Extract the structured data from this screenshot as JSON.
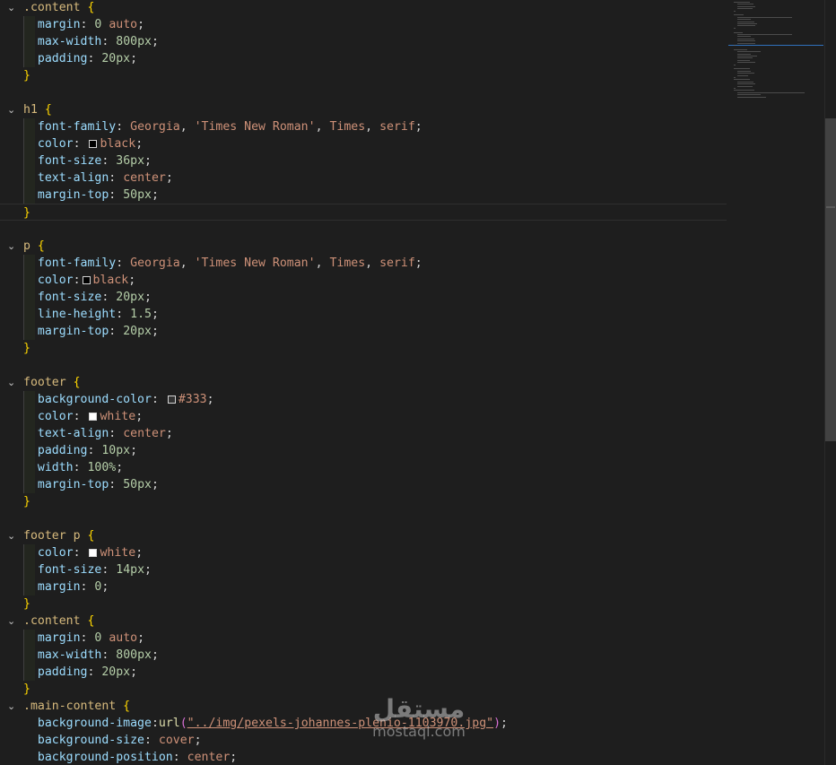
{
  "editor": {
    "lines": [
      {
        "kind": "open",
        "selector": ".content",
        "selClass": "sel"
      },
      {
        "kind": "decl",
        "prop": "margin",
        "parts": [
          {
            "t": "0",
            "c": "num"
          },
          {
            "t": " auto",
            "c": "val"
          }
        ]
      },
      {
        "kind": "decl",
        "prop": "max-width",
        "parts": [
          {
            "t": "800px",
            "c": "num"
          }
        ]
      },
      {
        "kind": "decl",
        "prop": "padding",
        "parts": [
          {
            "t": "20px",
            "c": "num"
          }
        ]
      },
      {
        "kind": "close"
      },
      {
        "kind": "blank"
      },
      {
        "kind": "open",
        "selector": "h1",
        "selClass": "tag"
      },
      {
        "kind": "decl",
        "prop": "font-family",
        "parts": [
          {
            "t": "Georgia",
            "c": "val"
          },
          {
            "t": ", ",
            "c": "punc"
          },
          {
            "t": "'Times New Roman'",
            "c": "str"
          },
          {
            "t": ", ",
            "c": "punc"
          },
          {
            "t": "Times",
            "c": "val"
          },
          {
            "t": ", ",
            "c": "punc"
          },
          {
            "t": "serif",
            "c": "val"
          }
        ]
      },
      {
        "kind": "decl",
        "prop": "color",
        "swatch": "#000000",
        "parts": [
          {
            "t": "black",
            "c": "val"
          }
        ]
      },
      {
        "kind": "decl",
        "prop": "font-size",
        "parts": [
          {
            "t": "36px",
            "c": "num"
          }
        ]
      },
      {
        "kind": "decl",
        "prop": "text-align",
        "parts": [
          {
            "t": "center",
            "c": "val"
          }
        ]
      },
      {
        "kind": "decl",
        "prop": "margin-top",
        "parts": [
          {
            "t": "50px",
            "c": "num"
          }
        ]
      },
      {
        "kind": "close",
        "current": true
      },
      {
        "kind": "blank"
      },
      {
        "kind": "open",
        "selector": "p",
        "selClass": "tag"
      },
      {
        "kind": "decl",
        "prop": "font-family",
        "parts": [
          {
            "t": "Georgia",
            "c": "val"
          },
          {
            "t": ", ",
            "c": "punc"
          },
          {
            "t": "'Times New Roman'",
            "c": "str"
          },
          {
            "t": ", ",
            "c": "punc"
          },
          {
            "t": "Times",
            "c": "val"
          },
          {
            "t": ", ",
            "c": "punc"
          },
          {
            "t": "serif",
            "c": "val"
          }
        ]
      },
      {
        "kind": "decl",
        "prop": "color",
        "nospace": true,
        "swatch": "#000000",
        "parts": [
          {
            "t": "black",
            "c": "val"
          }
        ]
      },
      {
        "kind": "decl",
        "prop": "font-size",
        "parts": [
          {
            "t": "20px",
            "c": "num"
          }
        ]
      },
      {
        "kind": "decl",
        "prop": "line-height",
        "parts": [
          {
            "t": "1.5",
            "c": "num"
          }
        ]
      },
      {
        "kind": "decl",
        "prop": "margin-top",
        "parts": [
          {
            "t": "20px",
            "c": "num"
          }
        ]
      },
      {
        "kind": "close"
      },
      {
        "kind": "blank"
      },
      {
        "kind": "open",
        "selector": "footer",
        "selClass": "tag"
      },
      {
        "kind": "decl",
        "prop": "background-color",
        "swatch": "#333333",
        "parts": [
          {
            "t": "#333",
            "c": "val"
          }
        ]
      },
      {
        "kind": "decl",
        "prop": "color",
        "swatch": "#ffffff",
        "parts": [
          {
            "t": "white",
            "c": "val"
          }
        ]
      },
      {
        "kind": "decl",
        "prop": "text-align",
        "parts": [
          {
            "t": "center",
            "c": "val"
          }
        ]
      },
      {
        "kind": "decl",
        "prop": "padding",
        "parts": [
          {
            "t": "10px",
            "c": "num"
          }
        ]
      },
      {
        "kind": "decl",
        "prop": "width",
        "parts": [
          {
            "t": "100%",
            "c": "num"
          }
        ]
      },
      {
        "kind": "decl",
        "prop": "margin-top",
        "parts": [
          {
            "t": "50px",
            "c": "num"
          }
        ]
      },
      {
        "kind": "close"
      },
      {
        "kind": "blank"
      },
      {
        "kind": "open",
        "selector": "footer p",
        "selClass": "tag"
      },
      {
        "kind": "decl",
        "prop": "color",
        "swatch": "#ffffff",
        "parts": [
          {
            "t": "white",
            "c": "val"
          }
        ]
      },
      {
        "kind": "decl",
        "prop": "font-size",
        "parts": [
          {
            "t": "14px",
            "c": "num"
          }
        ]
      },
      {
        "kind": "decl",
        "prop": "margin",
        "parts": [
          {
            "t": "0",
            "c": "num"
          }
        ]
      },
      {
        "kind": "close"
      },
      {
        "kind": "open",
        "selector": ".content",
        "selClass": "sel"
      },
      {
        "kind": "decl",
        "prop": "margin",
        "parts": [
          {
            "t": "0",
            "c": "num"
          },
          {
            "t": " auto",
            "c": "val"
          }
        ]
      },
      {
        "kind": "decl",
        "prop": "max-width",
        "parts": [
          {
            "t": "800px",
            "c": "num"
          }
        ]
      },
      {
        "kind": "decl",
        "prop": "padding",
        "parts": [
          {
            "t": "20px",
            "c": "num"
          }
        ]
      },
      {
        "kind": "close"
      },
      {
        "kind": "open",
        "selector": ".main-content",
        "selClass": "sel"
      },
      {
        "kind": "decl",
        "prop": "background-image",
        "nospace": true,
        "parts": [
          {
            "t": "url",
            "c": "fn"
          },
          {
            "t": "(",
            "c": "paren"
          },
          {
            "t": "\"../img/pexels-johannes-plenio-1103970.jpg\"",
            "c": "str url-underline"
          },
          {
            "t": ")",
            "c": "paren"
          }
        ]
      },
      {
        "kind": "decl",
        "prop": "background-size",
        "parts": [
          {
            "t": "cover",
            "c": "val"
          }
        ]
      },
      {
        "kind": "decl",
        "prop": "background-position",
        "parts": [
          {
            "t": "center",
            "c": "val"
          }
        ]
      }
    ]
  },
  "colors": {
    "background": "#1e1e1e",
    "selector": "#d7ba7d",
    "brace": "#ffd700",
    "property": "#9cdcfe",
    "string": "#ce9178",
    "number": "#b5cea8"
  },
  "icons": {
    "fold": "chevron-down-icon"
  },
  "watermark": {
    "mark": "مستقل",
    "text": "mostaql.com"
  }
}
